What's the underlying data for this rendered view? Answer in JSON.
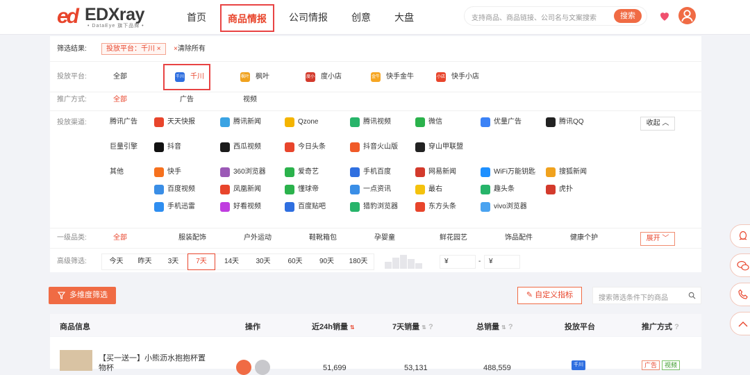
{
  "brand": {
    "mark": "ed",
    "name": "EDXray",
    "sub": "• DataEye 旗下品牌 •"
  },
  "nav": [
    {
      "label": "首页"
    },
    {
      "label": "商品情报",
      "active": true
    },
    {
      "label": "公司情报"
    },
    {
      "label": "创意"
    },
    {
      "label": "大盘"
    }
  ],
  "search": {
    "placeholder": "支持商品、商品链接、公司名与文案搜索",
    "button": "搜索"
  },
  "filter_result": {
    "label": "筛选结果:",
    "tag": "投放平台：千川",
    "clear": "清除所有"
  },
  "platform": {
    "label": "投放平台:",
    "options": [
      {
        "label": "全部"
      },
      {
        "label": "千川",
        "badge": "千川",
        "color": "#2f6fe0",
        "selected": true
      },
      {
        "label": "枫叶",
        "badge": "枫叶",
        "color": "#f0a21e"
      },
      {
        "label": "度小店",
        "badge": "度小店",
        "color": "#d33a2c"
      },
      {
        "label": "快手金牛",
        "badge": "金牛",
        "color": "#f6a623"
      },
      {
        "label": "快手小店",
        "badge": "小店",
        "color": "#e8452c"
      }
    ]
  },
  "promo": {
    "label": "推广方式:",
    "options": [
      "全部",
      "广告",
      "视频"
    ]
  },
  "channel": {
    "label": "投放渠道:",
    "collapse": "收起",
    "groups": [
      {
        "name": "腾讯广告",
        "rows": [
          [
            {
              "label": "天天快报",
              "color": "#e8452c"
            },
            {
              "label": "腾讯新闻",
              "color": "#3aa3e3"
            },
            {
              "label": "Qzone",
              "color": "#f4b400"
            },
            {
              "label": "腾讯视频",
              "color": "#27b46a"
            },
            {
              "label": "微信",
              "color": "#2bb24c"
            },
            {
              "label": "优量广告",
              "color": "#3b82f6"
            },
            {
              "label": "腾讯QQ",
              "color": "#222222"
            }
          ]
        ]
      },
      {
        "name": "巨量引擎",
        "rows": [
          [
            {
              "label": "抖音",
              "color": "#111111"
            },
            {
              "label": "西瓜视频",
              "color": "#1a1a1a"
            },
            {
              "label": "今日头条",
              "color": "#e8452c"
            },
            {
              "label": "抖音火山版",
              "color": "#f05a28"
            },
            {
              "label": "穿山甲联盟",
              "color": "#222222"
            }
          ]
        ]
      },
      {
        "name": "其他",
        "rows": [
          [
            {
              "label": "快手",
              "color": "#f6711e"
            },
            {
              "label": "360浏览器",
              "color": "#9b59b6"
            },
            {
              "label": "爱奇艺",
              "color": "#2bb24c"
            },
            {
              "label": "手机百度",
              "color": "#2f6fe0"
            },
            {
              "label": "网易新闻",
              "color": "#d33a2c"
            },
            {
              "label": "WiFi万能钥匙",
              "color": "#1e90ff"
            },
            {
              "label": "搜狐新闻",
              "color": "#f0a21e"
            }
          ],
          [
            {
              "label": "百度视频",
              "color": "#3a8ee6"
            },
            {
              "label": "凤凰新闻",
              "color": "#e8452c"
            },
            {
              "label": "懂球帝",
              "color": "#2bb24c"
            },
            {
              "label": "一点资讯",
              "color": "#3a8ee6"
            },
            {
              "label": "最右",
              "color": "#f4c20d"
            },
            {
              "label": "趣头条",
              "color": "#27b46a"
            },
            {
              "label": "虎扑",
              "color": "#d33a2c"
            }
          ],
          [
            {
              "label": "手机迅雷",
              "color": "#2f8ef0"
            },
            {
              "label": "好看视频",
              "color": "#c03de0"
            },
            {
              "label": "百度贴吧",
              "color": "#2f6fe0"
            },
            {
              "label": "猎豹浏览器",
              "color": "#27b46a"
            },
            {
              "label": "东方头条",
              "color": "#e8452c"
            },
            {
              "label": "vivo浏览器",
              "color": "#4aa3f0"
            }
          ]
        ]
      }
    ]
  },
  "category": {
    "label": "一级品类:",
    "options": [
      "全部",
      "服装配饰",
      "户外运动",
      "鞋靴箱包",
      "孕婴童",
      "鲜花园艺",
      "饰品配件",
      "健康个护"
    ],
    "expand": "展开"
  },
  "advanced": {
    "label": "高级筛选:",
    "days": [
      "今天",
      "昨天",
      "3天",
      "7天",
      "14天",
      "30天",
      "60天",
      "90天",
      "180天"
    ],
    "selected_day": "7天",
    "currency": "¥",
    "dash": "-"
  },
  "toolbar": {
    "multi": "多维度筛选",
    "custom": "自定义指标",
    "search_placeholder": "搜索筛选条件下的商品"
  },
  "table": {
    "headers": [
      "商品信息",
      "操作",
      "近24h销量",
      "7天销量",
      "总销量",
      "投放平台",
      "推广方式"
    ],
    "rows": [
      {
        "title": "【买一送一】小熊沥水抱抱杯置",
        "title2": "物杯",
        "sales_24h": "51,699",
        "sales_7d": "53,131",
        "sales_total": "488,559",
        "platform": "千川",
        "tags": [
          "广告",
          "视频"
        ]
      }
    ]
  },
  "colors": {
    "accent": "#e8452c",
    "button": "#f06b44",
    "highlight": "#e84343"
  }
}
